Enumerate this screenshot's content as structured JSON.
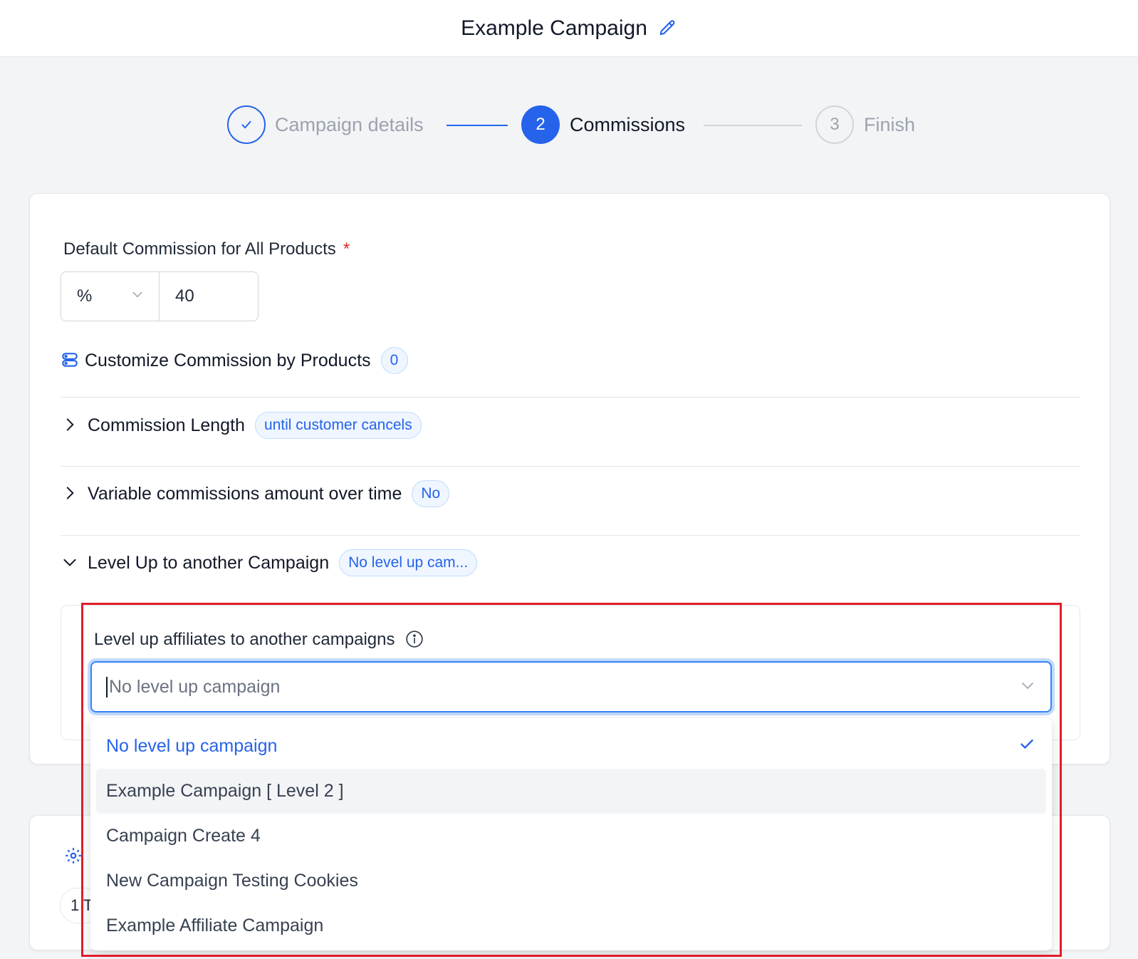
{
  "header": {
    "title": "Example Campaign"
  },
  "stepper": {
    "steps": [
      {
        "number": "✓",
        "label": "Campaign details"
      },
      {
        "number": "2",
        "label": "Commissions"
      },
      {
        "number": "3",
        "label": "Finish"
      }
    ]
  },
  "commission": {
    "label": "Default Commission for All Products",
    "required_mark": "*",
    "unit": "%",
    "value": "40"
  },
  "customize": {
    "label": "Customize Commission by Products",
    "count": "0"
  },
  "length": {
    "label": "Commission Length",
    "badge": "until customer cancels"
  },
  "variable": {
    "label": "Variable commissions amount over time",
    "badge": "No"
  },
  "levelup": {
    "label": "Level Up to another Campaign",
    "badge": "No level up cam...",
    "field_label": "Level up affiliates to another campaigns",
    "placeholder": "No level up campaign",
    "options": [
      "No level up campaign",
      "Example Campaign [ Level 2 ]",
      "Campaign Create 4",
      "New Campaign Testing Cookies",
      "Example Affiliate Campaign"
    ]
  },
  "partial_card": {
    "pill_text": "1 T"
  },
  "colors": {
    "accent": "#2563eb",
    "highlight": "#e11d2a"
  }
}
